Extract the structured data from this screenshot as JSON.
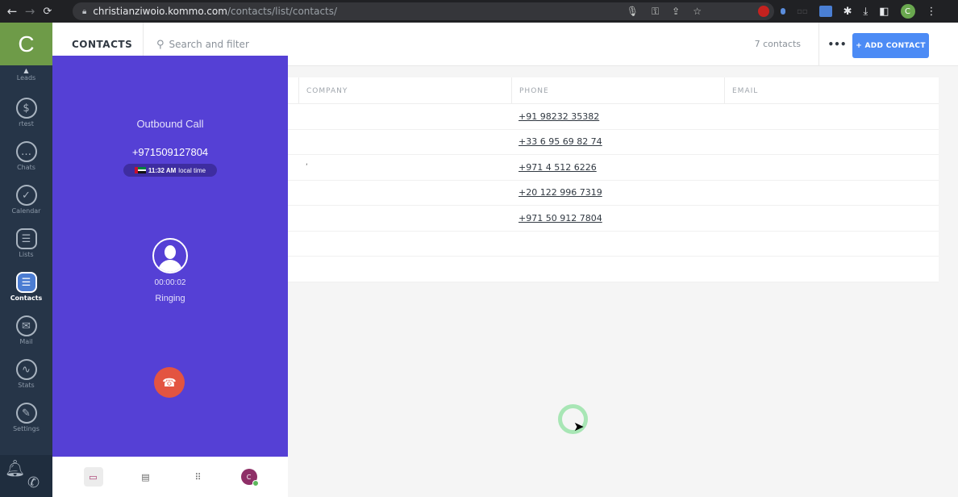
{
  "browser": {
    "back_icon": "←",
    "forward_icon": "→",
    "reload_icon": "C",
    "url_host": "christianziwoio.kommo.com",
    "url_path": "/contacts/list/contacts/",
    "profile_initial": "C"
  },
  "sidebar": {
    "logo_initial": "C",
    "items": [
      {
        "label": "Leads"
      },
      {
        "label": "rtest",
        "glyph": "$"
      },
      {
        "label": "Chats",
        "glyph": "…"
      },
      {
        "label": "Calendar",
        "glyph": "✓"
      },
      {
        "label": "Lists",
        "glyph": "☰"
      },
      {
        "label": "Contacts",
        "glyph": "☰",
        "active": true
      },
      {
        "label": "Mail",
        "glyph": "✉"
      },
      {
        "label": "Stats",
        "glyph": "∿"
      },
      {
        "label": "Settings",
        "glyph": "✎"
      }
    ]
  },
  "header": {
    "title": "CONTACTS",
    "search_placeholder": "Search and filter",
    "count": "7 contacts",
    "more_label": "•••",
    "add_button": "+ ADD CONTACT"
  },
  "table": {
    "columns": {
      "company": "COMPANY",
      "phone": "PHONE",
      "email": "EMAIL"
    },
    "rows": [
      {
        "company": "",
        "phone": "+91 98232 35382",
        "email": ""
      },
      {
        "company": "",
        "phone": "+33 6 95 69 82 74",
        "email": ""
      },
      {
        "company": "‘",
        "phone": "+971 4 512 6226",
        "email": ""
      },
      {
        "company": "",
        "phone": "+20 122 996 7319",
        "email": ""
      },
      {
        "company": "",
        "phone": "+971 50 912 7804",
        "email": ""
      },
      {
        "company": "",
        "phone": "",
        "email": ""
      },
      {
        "company": "",
        "phone": "",
        "email": ""
      }
    ]
  },
  "call": {
    "type": "Outbound Call",
    "number": "+971509127804",
    "local_time": "11:32 AM",
    "local_time_suffix": "local time",
    "timer": "00:00:02",
    "status": "Ringing",
    "accent_color": "#5540d5",
    "hangup_color": "#e35441"
  },
  "call_footer": {
    "avatar_initial": "C"
  }
}
